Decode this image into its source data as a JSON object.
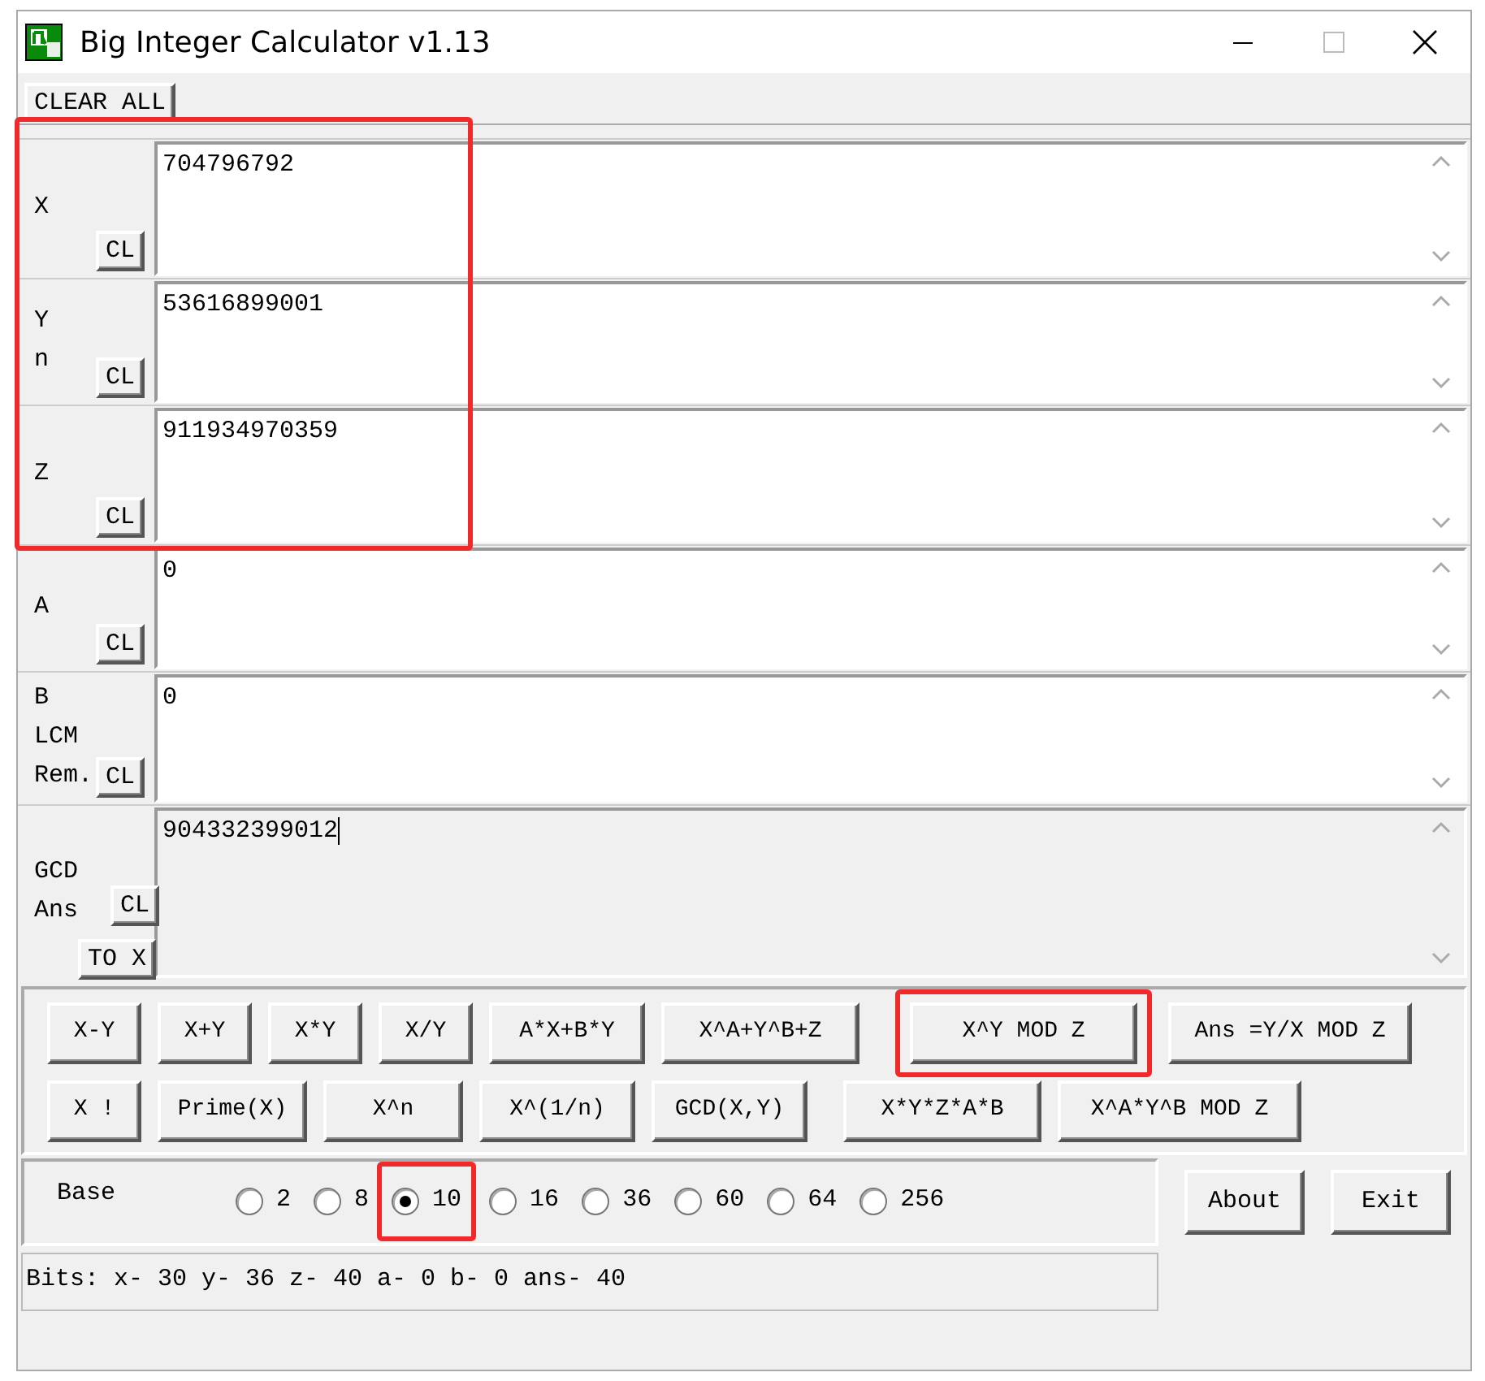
{
  "window": {
    "title": "Big Integer Calculator v1.13"
  },
  "clear_all": "CLEAR ALL",
  "fields": [
    {
      "labels": [
        "X"
      ],
      "clear": "CL",
      "value": "704796792",
      "readonly": false,
      "highlighted": true
    },
    {
      "labels": [
        "Y",
        "n"
      ],
      "clear": "CL",
      "value": "53616899001",
      "readonly": false,
      "highlighted": true
    },
    {
      "labels": [
        "Z"
      ],
      "clear": "CL",
      "value": "911934970359",
      "readonly": false,
      "highlighted": true
    },
    {
      "labels": [
        "A"
      ],
      "clear": "CL",
      "value": "0",
      "readonly": false,
      "highlighted": false
    },
    {
      "labels": [
        "B",
        "LCM",
        "Rem."
      ],
      "clear": "CL",
      "value": "0",
      "readonly": false,
      "highlighted": false
    },
    {
      "labels": [
        "GCD",
        "Ans"
      ],
      "clear": "CL",
      "extra_button": "TO X",
      "value": "904332399012",
      "readonly": true,
      "highlighted": false
    }
  ],
  "operation_rows": [
    [
      {
        "label": "X-Y",
        "highlighted": false
      },
      {
        "label": "X+Y",
        "highlighted": false
      },
      {
        "label": "X*Y",
        "highlighted": false
      },
      {
        "label": "X/Y",
        "highlighted": false
      },
      {
        "label": "A*X+B*Y",
        "highlighted": false
      },
      {
        "label": "X^A+Y^B+Z",
        "highlighted": false
      },
      {
        "label": "X^Y MOD Z",
        "highlighted": true
      },
      {
        "label": "Ans =Y/X MOD Z",
        "highlighted": false
      }
    ],
    [
      {
        "label": "X !",
        "highlighted": false
      },
      {
        "label": "Prime(X)",
        "highlighted": false
      },
      {
        "label": "X^n",
        "highlighted": false
      },
      {
        "label": "X^(1/n)",
        "highlighted": false
      },
      {
        "label": "GCD(X,Y)",
        "highlighted": false
      },
      {
        "label": "X*Y*Z*A*B",
        "highlighted": false
      },
      {
        "label": "X^A*Y^B MOD Z",
        "highlighted": false
      }
    ]
  ],
  "base": {
    "label": "Base",
    "options": [
      {
        "label": "2",
        "selected": false,
        "highlighted": false
      },
      {
        "label": "8",
        "selected": false,
        "highlighted": false
      },
      {
        "label": "10",
        "selected": true,
        "highlighted": true
      },
      {
        "label": "16",
        "selected": false,
        "highlighted": false
      },
      {
        "label": "36",
        "selected": false,
        "highlighted": false
      },
      {
        "label": "60",
        "selected": false,
        "highlighted": false
      },
      {
        "label": "64",
        "selected": false,
        "highlighted": false
      },
      {
        "label": "256",
        "selected": false,
        "highlighted": false
      }
    ]
  },
  "side_buttons": [
    "About",
    "Exit"
  ],
  "status_bar": "Bits: x- 30 y- 36 z- 40 a- 0 b- 0 ans- 40"
}
